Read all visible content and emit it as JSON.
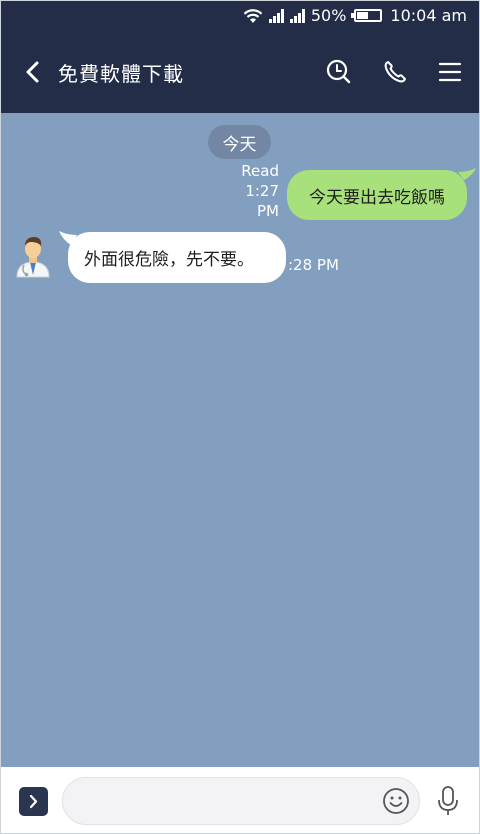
{
  "status_bar": {
    "battery": "50%",
    "battery_level": 0.5,
    "time": "10:04 am",
    "icons": [
      "wifi-icon",
      "signal-icon",
      "signal-icon",
      "battery-icon"
    ]
  },
  "header": {
    "title": "免費軟體下載",
    "icons": [
      "back-arrow-icon",
      "search-icon",
      "phone-icon",
      "menu-icon"
    ],
    "color": "#232d48"
  },
  "chat": {
    "background": "#839fc0",
    "date_separator": "今天",
    "messages": [
      {
        "direction": "outgoing",
        "text": "今天要出去吃飯嗎",
        "read_label": "Read",
        "time_line1": "1:27",
        "time_line2": "PM",
        "bubble_color": "#a8e17b"
      },
      {
        "direction": "incoming",
        "text": "外面很危險，先不要。",
        "time": ":28 PM",
        "avatar": "doctor-avatar-icon",
        "bubble_color": "#ffffff"
      }
    ]
  },
  "input_bar": {
    "placeholder": "",
    "icons": [
      "chevron-right-icon",
      "emoji-icon",
      "microphone-icon"
    ]
  }
}
